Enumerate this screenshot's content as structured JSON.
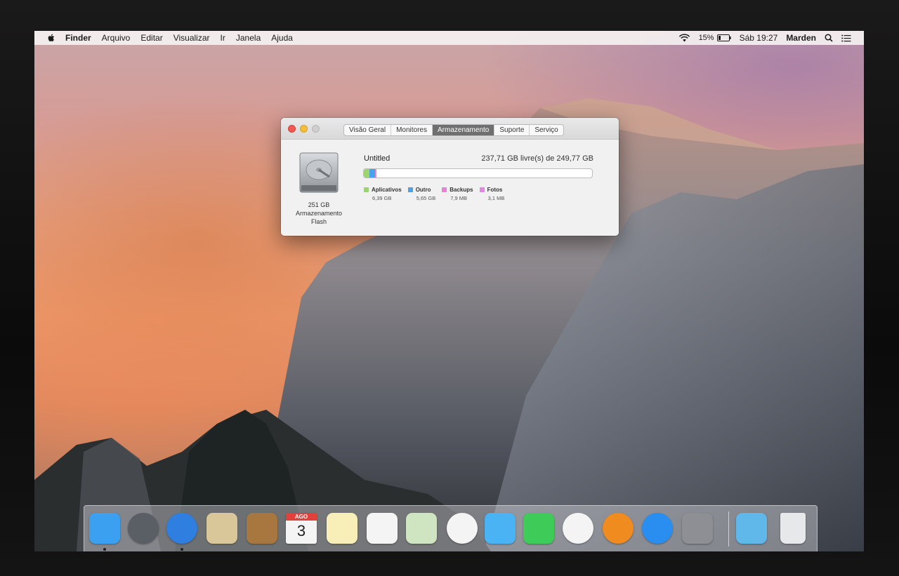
{
  "menubar": {
    "app": "Finder",
    "menus": [
      "Arquivo",
      "Editar",
      "Visualizar",
      "Ir",
      "Janela",
      "Ajuda"
    ],
    "battery": "15%",
    "clock": "Sáb 19:27",
    "user": "Marden"
  },
  "window": {
    "tabs": [
      "Visão Geral",
      "Monitores",
      "Armazenamento",
      "Suporte",
      "Serviço"
    ],
    "active_tab": "Armazenamento",
    "disk": {
      "size": "251 GB",
      "type_line1": "Armazenamento",
      "type_line2": "Flash"
    },
    "volume_name": "Untitled",
    "free_text": "237,71 GB livre(s) de 249,77 GB",
    "capacity_gb": 249.77,
    "legend": [
      {
        "label": "Aplicativos",
        "size": "6,39 GB",
        "color": "#9ed36f",
        "gb": 6.39
      },
      {
        "label": "Outro",
        "size": "5,65 GB",
        "color": "#4aa3ea",
        "gb": 5.65
      },
      {
        "label": "Backups",
        "size": "7,9 MB",
        "color": "#ef7fd3",
        "gb": 0.0079
      },
      {
        "label": "Fotos",
        "size": "3,1 MB",
        "color": "#e487e2",
        "gb": 0.0031
      }
    ]
  },
  "dock": {
    "items": [
      {
        "name": "finder-icon",
        "color": "#3aa0ef",
        "running": true
      },
      {
        "name": "launchpad-icon",
        "color": "#5a5f66",
        "running": false
      },
      {
        "name": "safari-icon",
        "color": "#2f7fe0",
        "running": true
      },
      {
        "name": "mail-icon",
        "color": "#d9c79a",
        "running": false
      },
      {
        "name": "contacts-icon",
        "color": "#a7773f",
        "running": false
      },
      {
        "name": "calendar-icon",
        "color": "#f4f4f4",
        "running": false
      },
      {
        "name": "notes-icon",
        "color": "#f8efb8",
        "running": false
      },
      {
        "name": "reminders-icon",
        "color": "#f4f4f4",
        "running": false
      },
      {
        "name": "maps-icon",
        "color": "#cfe4c0",
        "running": false
      },
      {
        "name": "photos-icon",
        "color": "#f4f4f4",
        "running": false
      },
      {
        "name": "messages-icon",
        "color": "#4ab3f3",
        "running": false
      },
      {
        "name": "facetime-icon",
        "color": "#3fcb58",
        "running": false
      },
      {
        "name": "itunes-icon",
        "color": "#f4f4f4",
        "running": false
      },
      {
        "name": "ibooks-icon",
        "color": "#f08b1f",
        "running": false
      },
      {
        "name": "app-store-icon",
        "color": "#2a8ef0",
        "running": false
      },
      {
        "name": "system-preferences-icon",
        "color": "#8d8f94",
        "running": false
      },
      {
        "name": "downloads-folder-icon",
        "color": "#5fb7ea",
        "running": false
      },
      {
        "name": "trash-icon",
        "color": "#e6e8ea",
        "running": false
      }
    ],
    "calendar_month": "AGO",
    "calendar_day": "3"
  }
}
